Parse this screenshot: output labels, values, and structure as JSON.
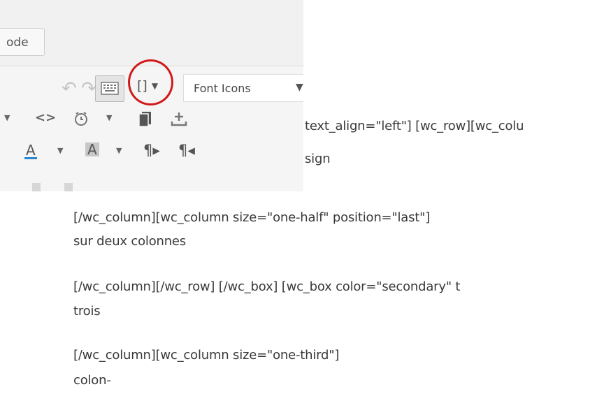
{
  "toolbar": {
    "code_tab_label": "ode",
    "shortcode_button_label": "[]",
    "font_select": {
      "label": "Font Icons"
    },
    "colors": {
      "highlight_ring": "#d11919",
      "text_color_underline": "#2a86d0"
    }
  },
  "document": {
    "lines": [
      "text_align=\"left\"] [wc_row][wc_colu",
      "sign",
      "[/wc_column][wc_column size=\"one-half\" position=\"last\"]",
      "sur deux colonnes",
      "[/wc_column][/wc_row] [/wc_box] [wc_box color=\"secondary\" t",
      "trois",
      "[/wc_column][wc_column size=\"one-third\"]",
      "colon-"
    ]
  }
}
